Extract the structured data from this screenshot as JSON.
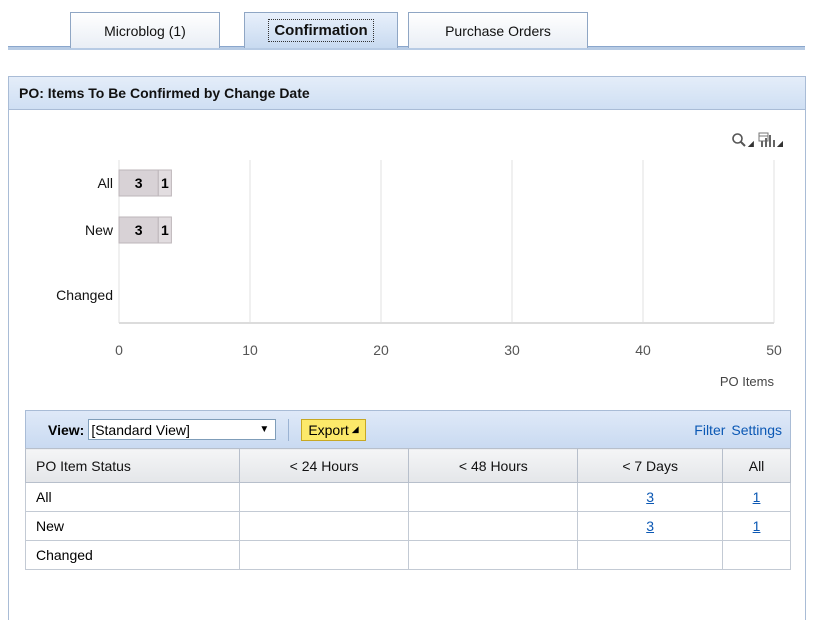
{
  "tabs": [
    {
      "label": "Microblog (1)",
      "active": false
    },
    {
      "label": "Confirmation",
      "active": true
    },
    {
      "label": "Purchase Orders",
      "active": false
    }
  ],
  "panel": {
    "title": "PO: Items To Be Confirmed by Change Date"
  },
  "chart_tools": {
    "zoom_icon": "magnifier-icon",
    "chart_type_icon": "chart-settings-icon"
  },
  "chart_data": {
    "type": "bar",
    "orientation": "horizontal",
    "stacked": true,
    "categories": [
      "All",
      "New",
      "Changed"
    ],
    "series": [
      {
        "values": [
          3,
          3,
          0
        ],
        "color": "#d8d2d6"
      },
      {
        "values": [
          1,
          1,
          0
        ],
        "color": "#e2dde0"
      }
    ],
    "data_labels": [
      [
        "3",
        "1"
      ],
      [
        "3",
        "1"
      ],
      []
    ],
    "xlabel": "PO Items",
    "xlim": [
      0,
      50
    ],
    "xticks": [
      0,
      10,
      20,
      30,
      40,
      50
    ],
    "grid": true
  },
  "toolbar": {
    "view_label": "View:",
    "view_value": "[Standard View]",
    "export_label": "Export",
    "filter_label": "Filter",
    "settings_label": "Settings"
  },
  "table": {
    "headers": [
      "PO Item Status",
      "< 24 Hours",
      "< 48 Hours",
      "< 7 Days",
      "All"
    ],
    "rows": [
      {
        "status": "All",
        "h24": "",
        "h48": "",
        "d7": "3",
        "all": "1"
      },
      {
        "status": "New",
        "h24": "",
        "h48": "",
        "d7": "3",
        "all": "1"
      },
      {
        "status": "Changed",
        "h24": "",
        "h48": "",
        "d7": "",
        "all": ""
      }
    ]
  }
}
